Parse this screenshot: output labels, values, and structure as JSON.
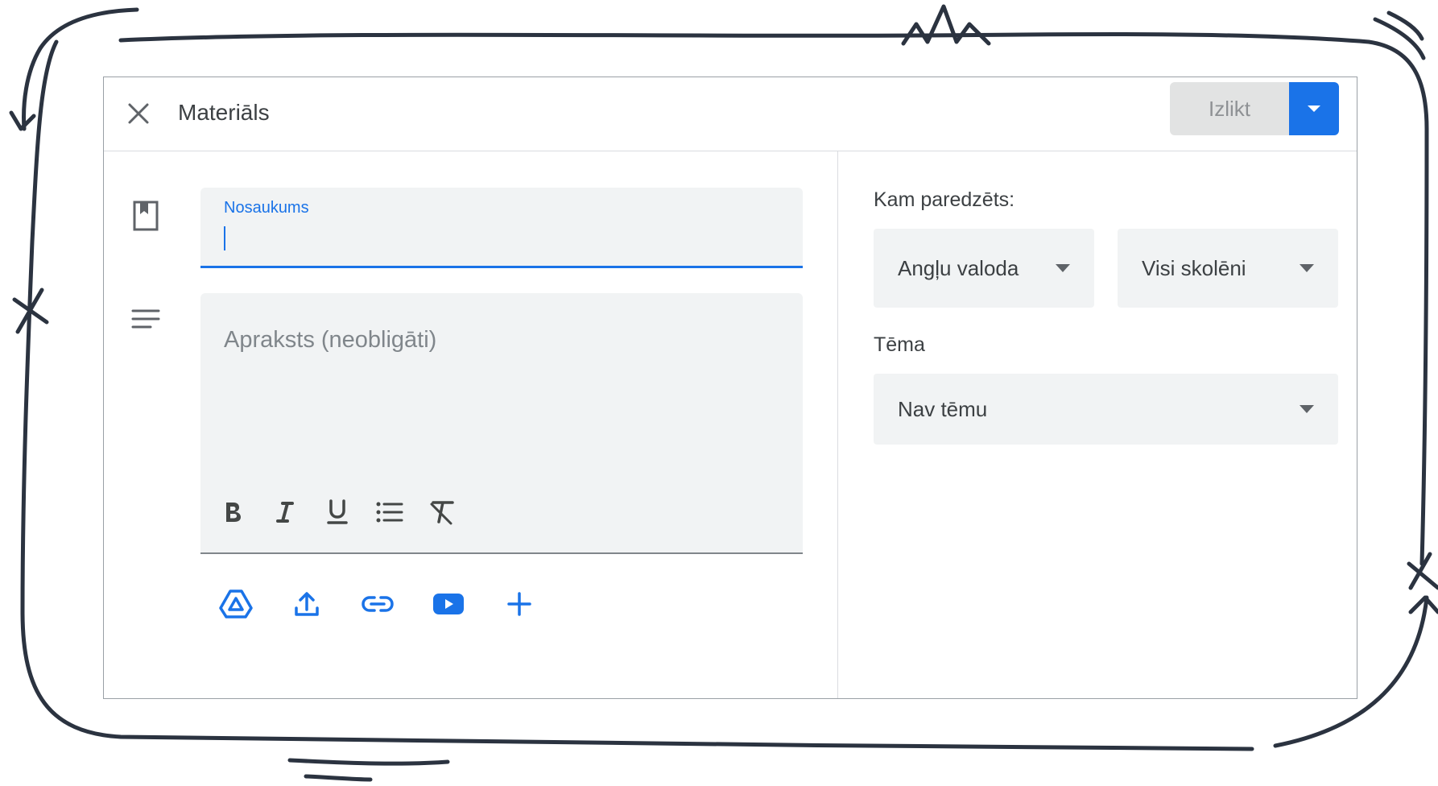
{
  "header": {
    "title": "Materiāls",
    "post_label": "Izlikt"
  },
  "form": {
    "title_label": "Nosaukums",
    "title_value": "",
    "description_placeholder": "Apraksts (neobligāti)"
  },
  "sidebar": {
    "for_label": "Kam paredzēts:",
    "class_value": "Angļu valoda",
    "students_value": "Visi skolēni",
    "topic_label": "Tēma",
    "topic_value": "Nav tēmu"
  },
  "colors": {
    "accent": "#1a73e8",
    "field_bg": "#f1f3f4",
    "disabled_button": "#e2e3e3",
    "doodle": "#2b3340"
  },
  "icons": {
    "header": [
      "close-icon",
      "dropdown-arrow-icon"
    ],
    "left": [
      "bookmark-icon",
      "text-lines-icon"
    ],
    "formatting": [
      "bold-icon",
      "italic-icon",
      "underline-icon",
      "bulleted-list-icon",
      "clear-formatting-icon"
    ],
    "attachments": [
      "google-drive-icon",
      "upload-icon",
      "link-icon",
      "youtube-icon",
      "add-icon"
    ]
  }
}
